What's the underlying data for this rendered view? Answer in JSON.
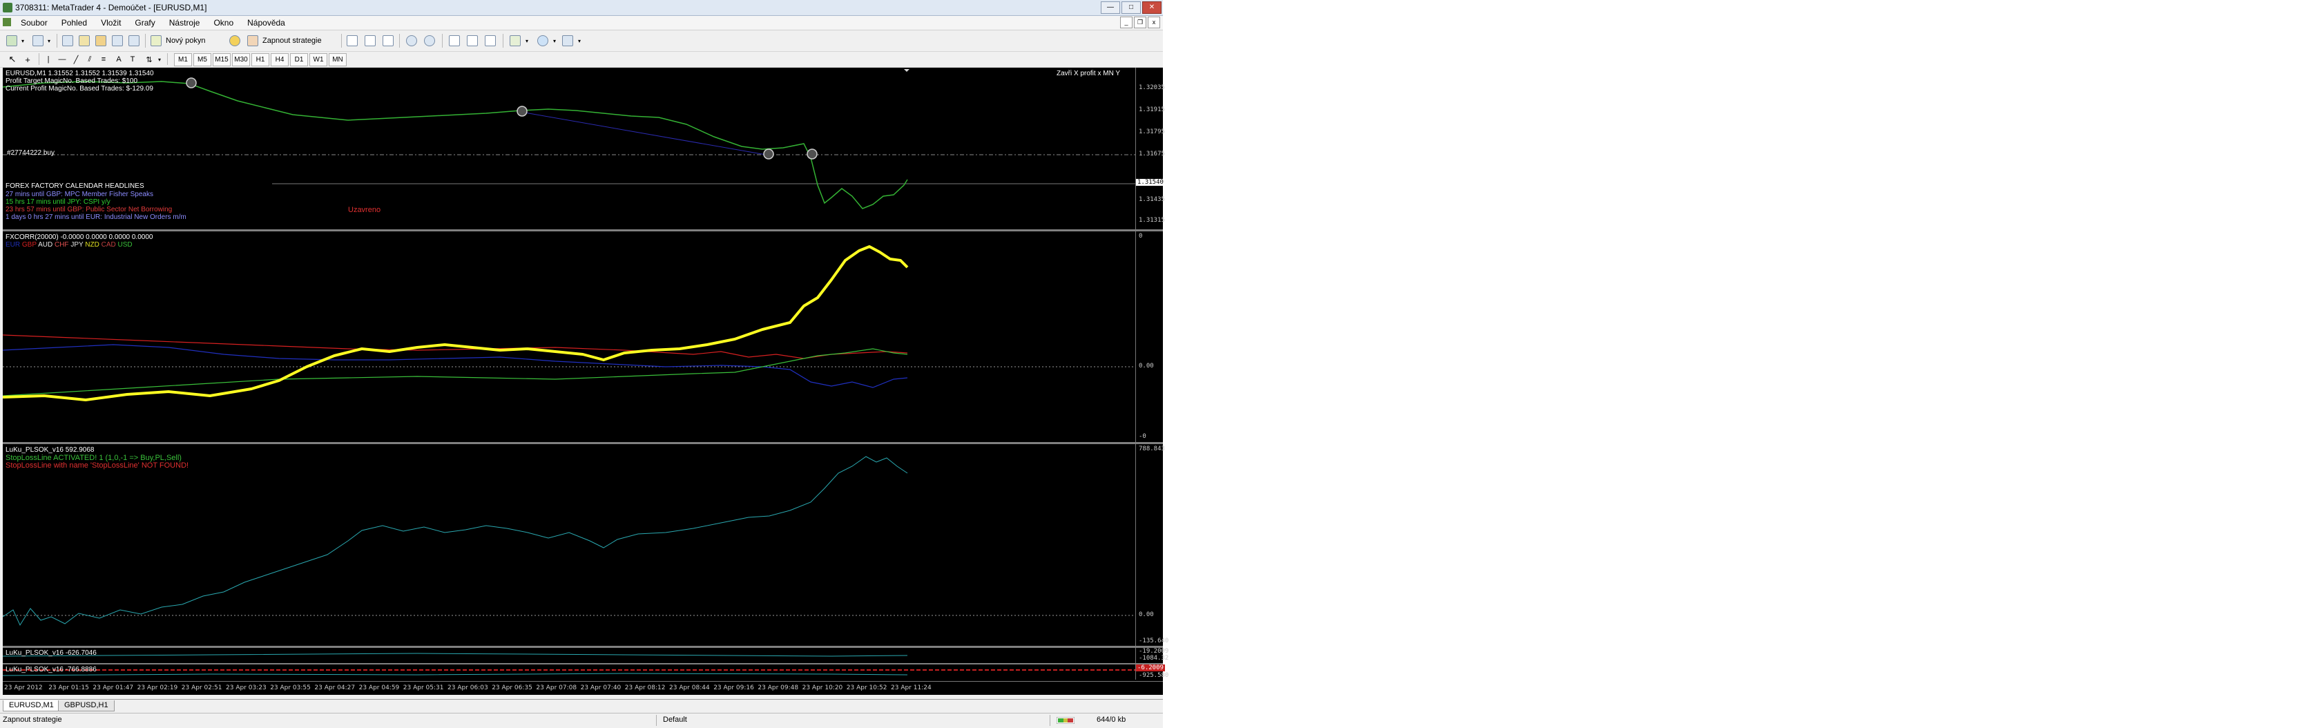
{
  "window": {
    "title": "3708311: MetaTrader 4 - Demoúčet - [EURUSD,M1]"
  },
  "menu": [
    "Soubor",
    "Pohled",
    "Vložit",
    "Grafy",
    "Nástroje",
    "Okno",
    "Nápověda"
  ],
  "toolbar": {
    "new_order": "Nový pokyn",
    "start_strategy": "Zapnout strategie"
  },
  "timeframes": [
    "M1",
    "M5",
    "M15",
    "M30",
    "H1",
    "H4",
    "D1",
    "W1",
    "MN"
  ],
  "main_pane": {
    "header": "EURUSD,M1  1.31552 1.31552 1.31539 1.31540",
    "info1": "Profit Target MagicNo. Based Trades: $100",
    "info2": "Current Profit MagicNo. Based Trades: $-129.09",
    "close_label": "Zavři X profit  x MN Y",
    "order_label": "#27744222 buy",
    "unknown_label": "Uzavreno",
    "news": {
      "title": "FOREX FACTORY CALENDAR HEADLINES",
      "items": [
        {
          "text": "27 mins until GBP: MPC Member Fisher Speaks",
          "color": "#8c8cff"
        },
        {
          "text": "15 hrs 17 mins until JPY: CSPI y/y",
          "color": "#31d131"
        },
        {
          "text": "23 hrs 57 mins until GBP: Public Sector Net Borrowing",
          "color": "#e33b3b"
        },
        {
          "text": "1 days 0 hrs 27 mins until EUR: Industrial New Orders m/m",
          "color": "#8c8cff"
        }
      ]
    },
    "prices": [
      "1.32035",
      "1.31915",
      "1.31795",
      "1.31675",
      "1.31540",
      "1.31435",
      "1.31315"
    ],
    "current_price": "1.31540"
  },
  "fxcorr_pane": {
    "header": "FXCORR(20000) -0.0000 0.0000 0.0000 0.0000",
    "currencies": [
      {
        "code": "EUR",
        "color": "#1f2fb5"
      },
      {
        "code": "GBP",
        "color": "#d62020"
      },
      {
        "code": "AUD",
        "color": "#e8e8e8"
      },
      {
        "code": "CHF",
        "color": "#e05050"
      },
      {
        "code": "JPY",
        "color": "#e0e0e0"
      },
      {
        "code": "NZD",
        "color": "#e0e020"
      },
      {
        "code": "CAD",
        "color": "#c04040"
      },
      {
        "code": "USD",
        "color": "#3ac03a"
      }
    ],
    "scale": [
      "0",
      "0.00",
      "-0"
    ]
  },
  "luku_pane": {
    "header": "LuKu_PLSOK_v16 592.9068",
    "line1": "StopLossLine ACTIVATED! 1 (1,0,-1 => Buy,PL,Sell)",
    "line2": "StopLossLine with name 'StopLossLine' NOT FOUND!",
    "scale": [
      "788.843",
      "0.00",
      "-135.640"
    ]
  },
  "small_pane1": {
    "header": "LuKu_PLSOK_v16 -626.7046",
    "scale": [
      "-19.2009",
      "-1084.32"
    ]
  },
  "small_pane2": {
    "header": "LuKu_PLSOK_v16 -766.8886",
    "scale": [
      "-6.2009",
      "-925.580"
    ]
  },
  "time_axis": [
    "23 Apr 2012",
    "23 Apr 01:15",
    "23 Apr 01:47",
    "23 Apr 02:19",
    "23 Apr 02:51",
    "23 Apr 03:23",
    "23 Apr 03:55",
    "23 Apr 04:27",
    "23 Apr 04:59",
    "23 Apr 05:31",
    "23 Apr 06:03",
    "23 Apr 06:35",
    "23 Apr 07:08",
    "23 Apr 07:40",
    "23 Apr 08:12",
    "23 Apr 08:44",
    "23 Apr 09:16",
    "23 Apr 09:48",
    "23 Apr 10:20",
    "23 Apr 10:52",
    "23 Apr 11:24"
  ],
  "tabs": [
    "EURUSD,M1",
    "GBPUSD,H1"
  ],
  "status": {
    "left": "Zapnout strategie",
    "profile": "Default",
    "traffic": "644/0 kb"
  }
}
